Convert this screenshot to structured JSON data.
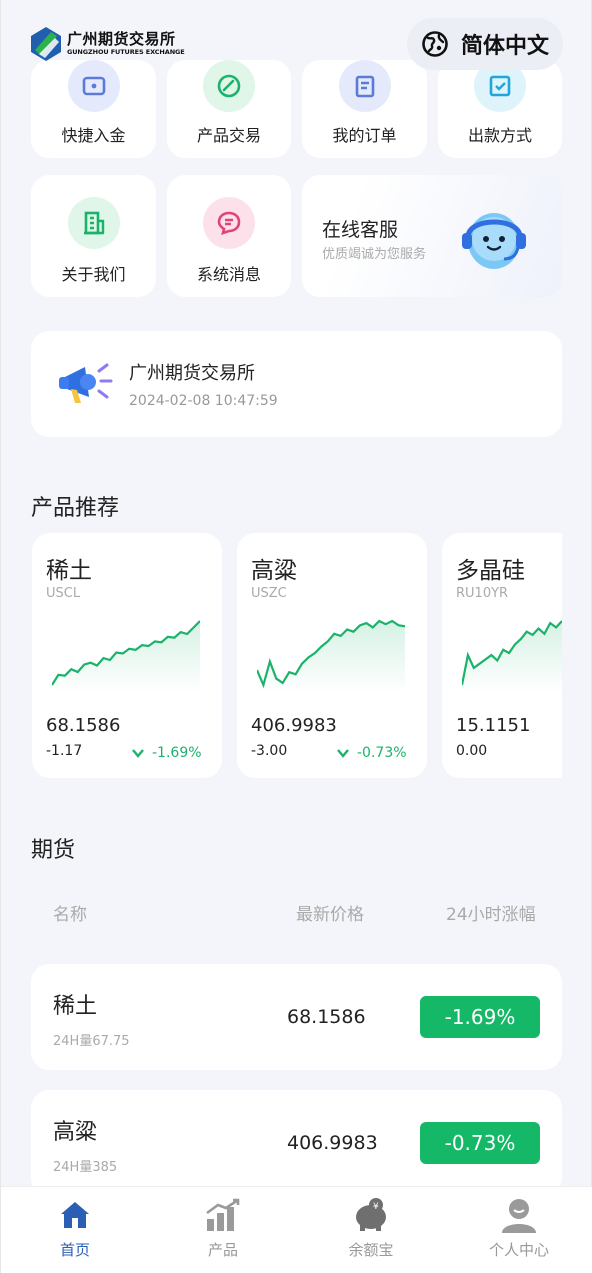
{
  "header": {
    "logo_cn": "广州期货交易所",
    "logo_en": "GUNGZHOU FUTURES EXCHANGE",
    "language_label": "简体中文",
    "logo_colors": [
      "#1f5fae",
      "#2bb24c"
    ]
  },
  "quick_menu": [
    {
      "label": "快捷入金",
      "icon": "wallet-icon",
      "color": "#5b7bd6",
      "bg": "#e4eafb"
    },
    {
      "label": "产品交易",
      "icon": "trade-icon",
      "color": "#1bb36b",
      "bg": "#dff6e8"
    },
    {
      "label": "我的订单",
      "icon": "order-icon",
      "color": "#5b7bd6",
      "bg": "#e4eafb"
    },
    {
      "label": "出款方式",
      "icon": "withdraw-icon",
      "color": "#20a6d8",
      "bg": "#dff3fb"
    },
    {
      "label": "关于我们",
      "icon": "building-icon",
      "color": "#1bb36b",
      "bg": "#dff6e8"
    },
    {
      "label": "系统消息",
      "icon": "message-icon",
      "color": "#e0457a",
      "bg": "#fde1ea"
    }
  ],
  "customer_service": {
    "title": "在线客服",
    "subtitle": "优质竭诚为您服务"
  },
  "notice": {
    "title": "广州期货交易所",
    "time": "2024-02-08 10:47:59"
  },
  "sections": {
    "recommend_title": "产品推荐",
    "futures_title": "期货"
  },
  "recommend": [
    {
      "name": "稀土",
      "code": "USCL",
      "price": "68.1586",
      "change": "-1.17",
      "pct": "-1.69%",
      "trend": [
        3,
        14,
        13,
        20,
        17,
        25,
        27,
        24,
        32,
        30,
        38,
        37,
        42,
        41,
        46,
        45,
        50,
        49,
        55,
        54,
        60,
        58,
        65,
        72
      ]
    },
    {
      "name": "高粱",
      "code": "USZC",
      "price": "406.9983",
      "change": "-3.00",
      "pct": "-0.73%",
      "trend": [
        22,
        8,
        30,
        14,
        10,
        20,
        18,
        28,
        34,
        38,
        44,
        49,
        56,
        54,
        60,
        58,
        64,
        66,
        62,
        68,
        65,
        68,
        64,
        63
      ]
    },
    {
      "name": "多晶硅",
      "code": "RU10YR",
      "price": "15.1151",
      "change": "0.00",
      "pct": "",
      "trend": [
        2,
        30,
        18,
        22,
        26,
        30,
        25,
        35,
        32,
        40,
        45,
        52,
        49,
        55,
        50,
        60,
        56,
        62
      ]
    }
  ],
  "table": {
    "col_name": "名称",
    "col_price": "最新价格",
    "col_change": "24小时涨幅",
    "rows": [
      {
        "name": "稀土",
        "volume": "24H量67.75",
        "price": "68.1586",
        "change": "-1.69%"
      },
      {
        "name": "高粱",
        "volume": "24H量385",
        "price": "406.9983",
        "change": "-0.73%"
      }
    ]
  },
  "tabbar": [
    {
      "label": "首页",
      "icon": "home-icon",
      "active": true
    },
    {
      "label": "产品",
      "icon": "bar-chart-icon",
      "active": false
    },
    {
      "label": "余额宝",
      "icon": "piggy-bank-icon",
      "active": false
    },
    {
      "label": "个人中心",
      "icon": "user-icon",
      "active": false
    }
  ],
  "colors": {
    "accent_blue": "#2b5fb3",
    "up_green": "#15b866",
    "background": "#f4f5fa"
  }
}
